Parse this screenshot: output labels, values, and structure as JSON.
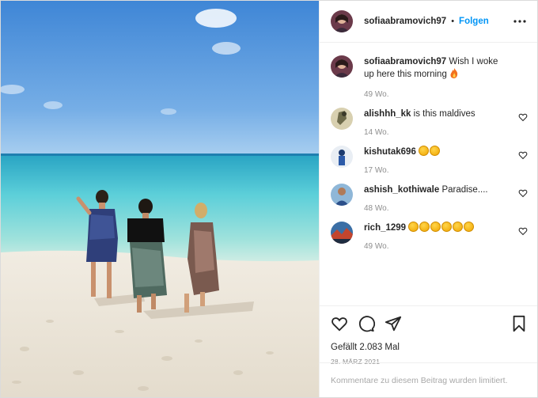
{
  "post": {
    "author": "sofiaabramovich97",
    "dot": "•",
    "follow_label": "Folgen",
    "caption": {
      "user": "sofiaabramovich97",
      "text": "Wish I woke up here this morning",
      "age": "49 Wo."
    },
    "comments": [
      {
        "user": "alishhh_kk",
        "text": "is this maldives",
        "emoji_count": 0,
        "age": "14 Wo."
      },
      {
        "user": "kishutak696",
        "text": "",
        "emoji_count": 2,
        "age": "17 Wo."
      },
      {
        "user": "ashish_kothiwale",
        "text": "Paradise....",
        "emoji_count": 0,
        "age": "48 Wo."
      },
      {
        "user": "rich_1299",
        "text": "",
        "emoji_count": 6,
        "age": "49 Wo."
      }
    ],
    "likes": "Gefällt 2.083 Mal",
    "date": "28. MÄRZ 2021",
    "comments_limited": "Kommentare zu diesem Beitrag wurden limitiert."
  },
  "icons": {
    "header": [
      "avatar",
      "more-options-icon"
    ],
    "actions": [
      "heart-icon",
      "comment-icon",
      "share-icon",
      "bookmark-icon"
    ],
    "comment_like": "heart-icon"
  },
  "colors": {
    "follow_blue": "#0095f6",
    "secondary_text": "#8e8e8e",
    "border": "#efefef"
  }
}
